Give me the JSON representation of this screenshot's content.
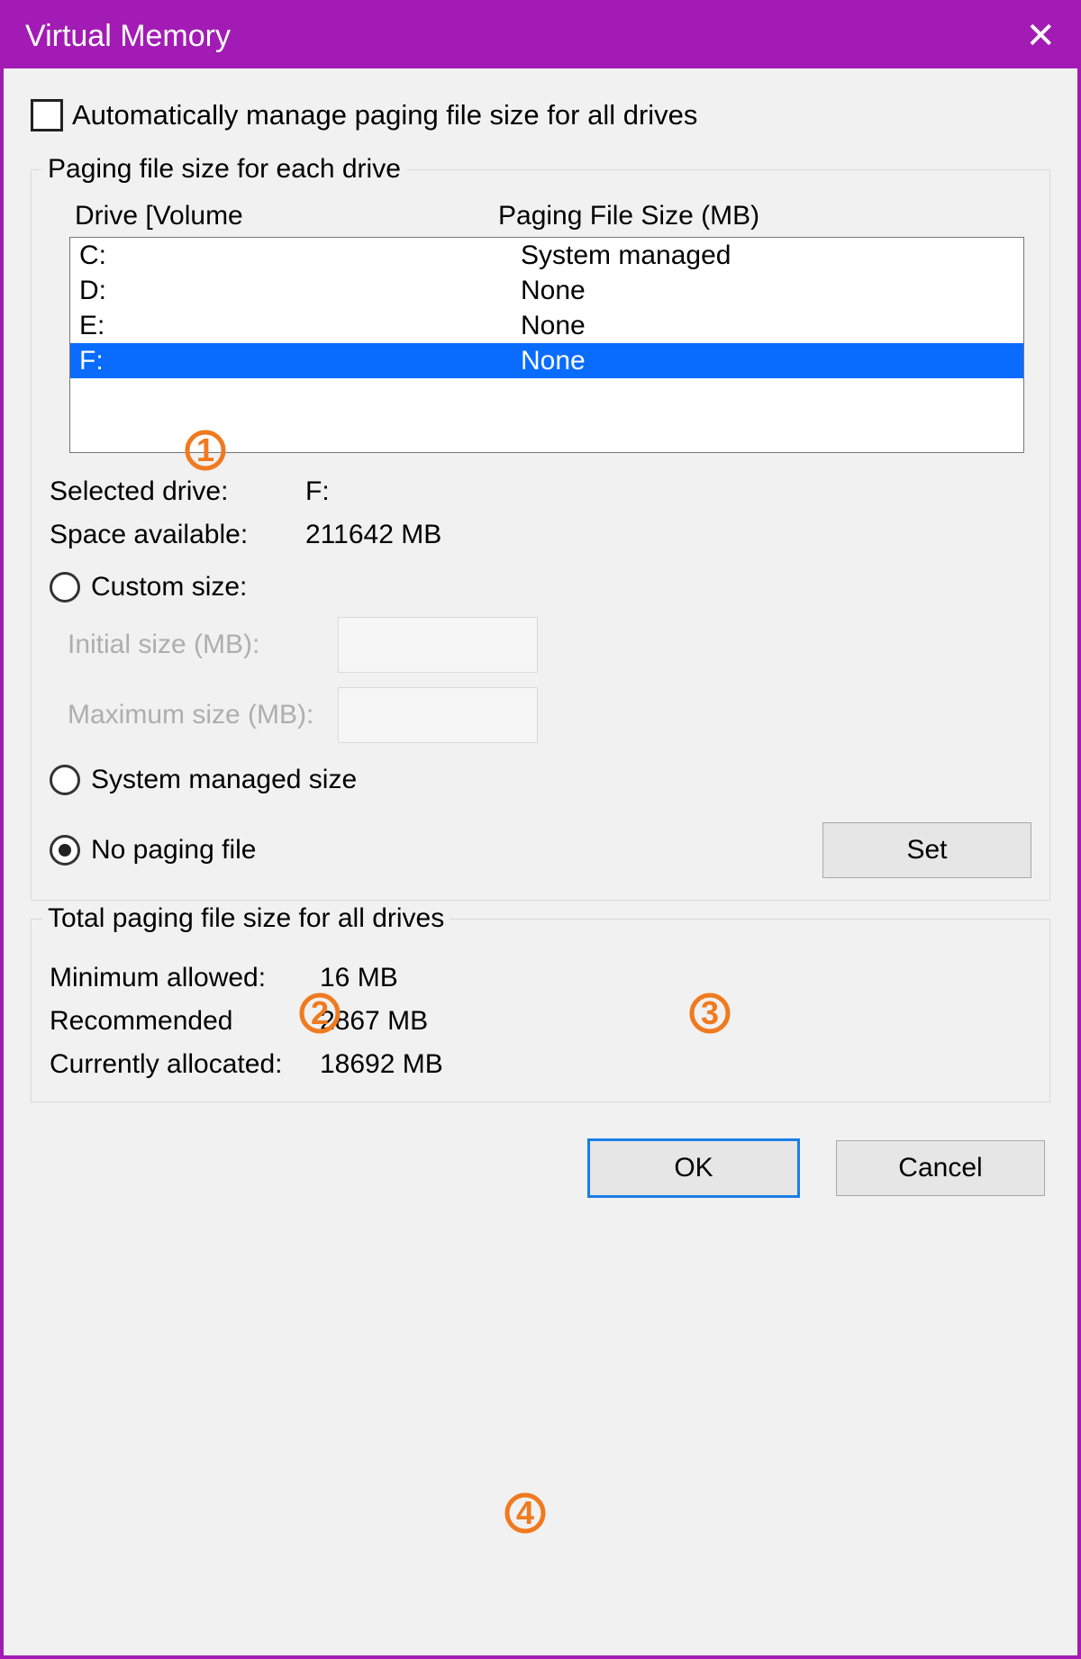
{
  "window": {
    "title": "Virtual Memory"
  },
  "auto_manage": {
    "label": "Automatically manage paging file size for all drives",
    "checked": false
  },
  "drive_group": {
    "legend": "Paging file size for each drive",
    "header_drive": "Drive  [Volume",
    "header_size": "Paging File Size (MB)",
    "rows": [
      {
        "drive": "C:",
        "size": "System managed",
        "selected": false
      },
      {
        "drive": "D:",
        "size": "None",
        "selected": false
      },
      {
        "drive": "E:",
        "size": "None",
        "selected": false
      },
      {
        "drive": "F:",
        "size": "None",
        "selected": true
      }
    ],
    "selected_drive_label": "Selected drive:",
    "selected_drive_value": "F:",
    "space_available_label": "Space available:",
    "space_available_value": "211642 MB",
    "radio_custom": "Custom size:",
    "initial_label": "Initial size (MB):",
    "maximum_label": "Maximum size (MB):",
    "radio_system_managed": "System managed size",
    "radio_no_paging": "No paging file",
    "selected_radio": "no_paging",
    "set_button": "Set"
  },
  "totals_group": {
    "legend": "Total paging file size for all drives",
    "minimum_label": "Minimum allowed:",
    "minimum_value": "16 MB",
    "recommended_label": "Recommended",
    "recommended_value": "2867 MB",
    "current_label": "Currently allocated:",
    "current_value": "18692 MB"
  },
  "buttons": {
    "ok": "OK",
    "cancel": "Cancel"
  },
  "annotations": {
    "a1": "1",
    "a2": "2",
    "a3": "3",
    "a4": "4"
  }
}
